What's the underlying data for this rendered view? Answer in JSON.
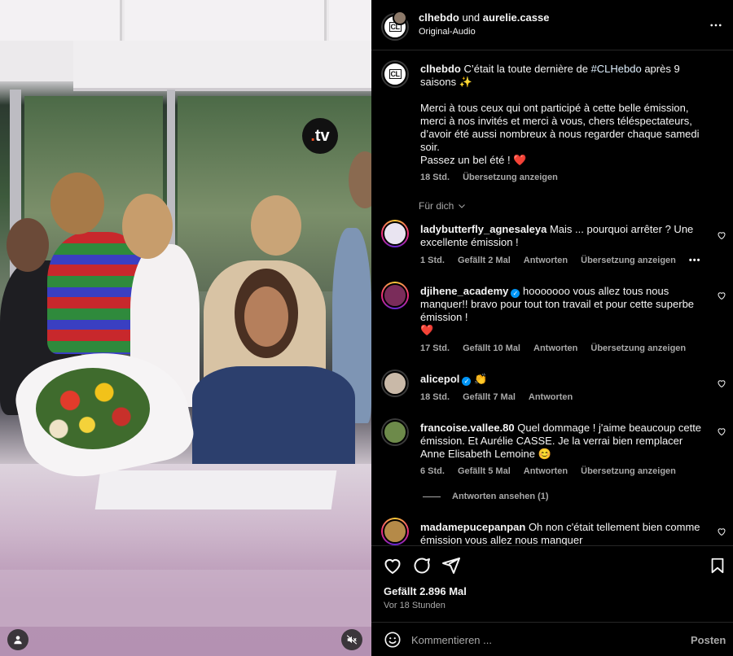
{
  "media": {
    "overlay_logo_text": ".tv",
    "user_tag_icon": "person-icon",
    "mute_icon": "speaker-muted-icon"
  },
  "header": {
    "author": "clhebdo",
    "connector": "und",
    "collaborator": "aurelie.casse",
    "audio": "Original-Audio",
    "more_icon": "more-horizontal-icon",
    "avatar_text": "CL"
  },
  "caption": {
    "author": "clhebdo",
    "text_before": " C’était la toute dernière de ",
    "hashtag": "#CLHebdo",
    "text_after": " après 9 saisons ✨",
    "paragraph2": "Merci à tous ceux qui ont participé à cette belle émission, merci à nos invités et merci à vous, chers téléspectateurs, d’avoir été aussi nombreux à nous regarder chaque samedi soir.",
    "paragraph3": "Passez un bel été ! ❤️",
    "time": "18 Std.",
    "translate": "Übersetzung anzeigen"
  },
  "filter": {
    "label": "Für dich"
  },
  "comments": [
    {
      "user": "ladybutterfly_agnesaleya",
      "text": " Mais ... pourquoi arrêter ? Une excellente émission !",
      "time": "1 Std.",
      "likes": "Gefällt 2 Mal",
      "reply": "Antworten",
      "translate": "Übersetzung anzeigen",
      "verified": false
    },
    {
      "user": "djihene_academy",
      "text": " hooooooo vous allez tous nous manquer!! bravo pour tout ton travail et pour cette superbe émission !",
      "text2": "❤️",
      "time": "17 Std.",
      "likes": "Gefällt 10 Mal",
      "reply": "Antworten",
      "translate": "Übersetzung anzeigen",
      "verified": true
    },
    {
      "user": "alicepol",
      "text": " 👏",
      "time": "18 Std.",
      "likes": "Gefällt 7 Mal",
      "reply": "Antworten",
      "verified": true
    },
    {
      "user": "francoise.vallee.80",
      "text": " Quel dommage ! j'aime beaucoup cette émission. Et Aurélie CASSE. Je la verrai bien remplacer Anne Elisabeth Lemoine 😊",
      "time": "6 Std.",
      "likes": "Gefällt 5 Mal",
      "reply": "Antworten",
      "translate": "Übersetzung anzeigen",
      "view_replies": "Antworten ansehen (1)",
      "verified": false
    },
    {
      "user": "madamepucepanpan",
      "text": " Oh non c'était tellement bien comme émission vous allez nous manquer",
      "verified": false
    }
  ],
  "actions": {
    "likes": "Gefällt 2.896 Mal",
    "posted": "Vor 18 Stunden",
    "like_icon": "heart-icon",
    "comment_icon": "comment-icon",
    "share_icon": "send-icon",
    "save_icon": "bookmark-icon"
  },
  "compose": {
    "placeholder": "Kommentieren ...",
    "post": "Posten",
    "emoji_icon": "emoji-icon"
  },
  "colors": {
    "link": "#e0f1ff",
    "muted": "#a8a8a8",
    "verified": "#0095f6",
    "heart": "#ff3040"
  }
}
